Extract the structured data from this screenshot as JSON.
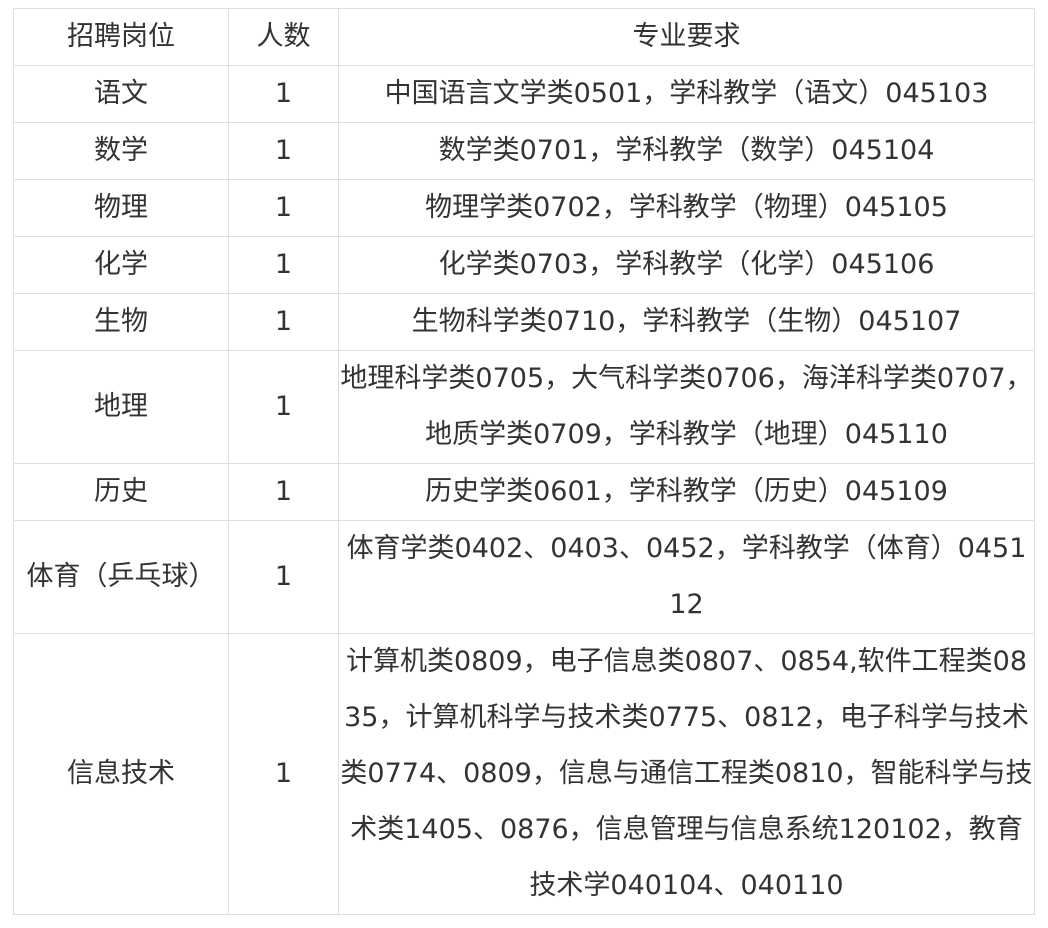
{
  "table": {
    "headers": [
      "招聘岗位",
      "人数",
      "专业要求"
    ],
    "rows": [
      {
        "position": "语文",
        "count": "1",
        "requirement": "中国语言文学类0501，学科教学（语文）045103"
      },
      {
        "position": "数学",
        "count": "1",
        "requirement": "数学类0701，学科教学（数学）045104"
      },
      {
        "position": "物理",
        "count": "1",
        "requirement": "物理学类0702，学科教学（物理）045105"
      },
      {
        "position": "化学",
        "count": "1",
        "requirement": "化学类0703，学科教学（化学）045106"
      },
      {
        "position": "生物",
        "count": "1",
        "requirement": "生物科学类0710，学科教学（生物）045107"
      },
      {
        "position": "地理",
        "count": "1",
        "requirement": "地理科学类0705，大气科学类0706，海洋科学类0707，地质学类0709，学科教学（地理）045110"
      },
      {
        "position": "历史",
        "count": "1",
        "requirement": "历史学类0601，学科教学（历史）045109"
      },
      {
        "position": "体育（乒乓球）",
        "count": "1",
        "requirement": "体育学类0402、0403、0452，学科教学（体育）045112"
      },
      {
        "position": "信息技术",
        "count": "1",
        "requirement": "计算机类0809，电子信息类0807、0854,软件工程类0835，计算机科学与技术类0775、0812，电子科学与技术类0774、0809，信息与通信工程类0810，智能科学与技术类1405、0876，信息管理与信息系统120102，教育技术学040104、040110"
      }
    ]
  }
}
